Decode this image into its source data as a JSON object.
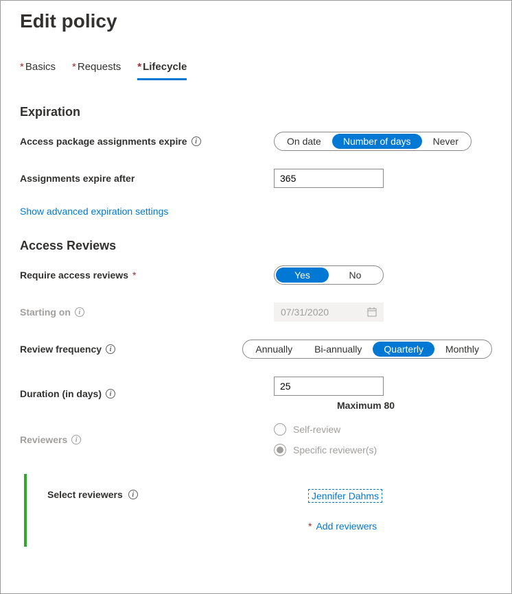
{
  "title": "Edit policy",
  "tabs": [
    {
      "label": "Basics",
      "required": true,
      "active": false
    },
    {
      "label": "Requests",
      "required": true,
      "active": false
    },
    {
      "label": "Lifecycle",
      "required": true,
      "active": true
    }
  ],
  "expiration": {
    "heading": "Expiration",
    "assignments_expire_label": "Access package assignments expire",
    "assignments_expire_options": [
      "On date",
      "Number of days",
      "Never"
    ],
    "assignments_expire_selected": "Number of days",
    "expire_after_label": "Assignments expire after",
    "expire_after_value": "365",
    "advanced_link": "Show advanced expiration settings"
  },
  "access_reviews": {
    "heading": "Access Reviews",
    "require_label": "Require access reviews",
    "require_options": [
      "Yes",
      "No"
    ],
    "require_selected": "Yes",
    "starting_label": "Starting on",
    "starting_value": "07/31/2020",
    "frequency_label": "Review frequency",
    "frequency_options": [
      "Annually",
      "Bi-annually",
      "Quarterly",
      "Monthly"
    ],
    "frequency_selected": "Quarterly",
    "duration_label": "Duration (in days)",
    "duration_value": "25",
    "duration_helper": "Maximum 80",
    "reviewers_label": "Reviewers",
    "reviewer_options": [
      "Self-review",
      "Specific reviewer(s)"
    ],
    "reviewer_selected": "Specific reviewer(s)",
    "select_reviewers_label": "Select reviewers",
    "selected_reviewer": "Jennifer Dahms",
    "add_reviewers_label": "Add reviewers"
  }
}
